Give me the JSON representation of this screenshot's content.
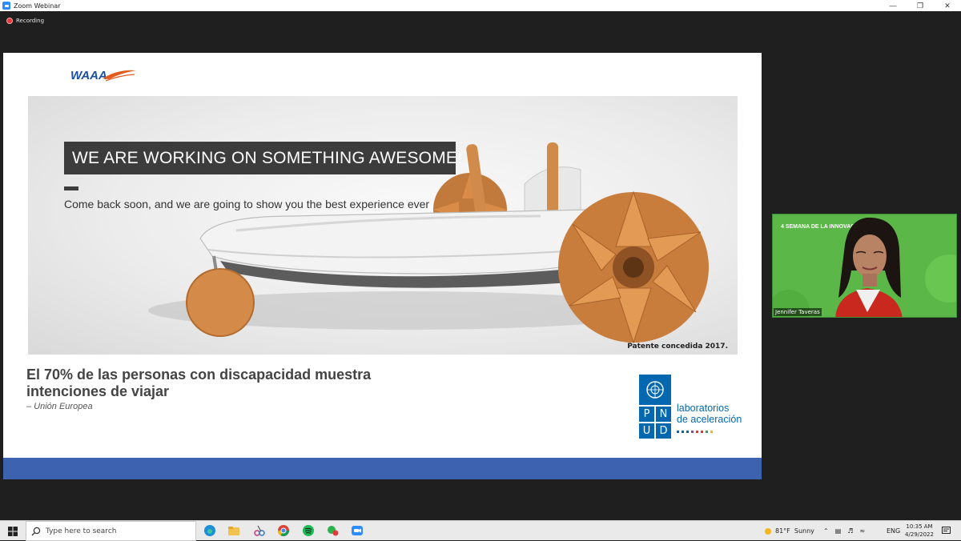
{
  "window": {
    "title": "Zoom Webinar",
    "recording_label": "Recording"
  },
  "slide": {
    "logo_text": "WAAA",
    "banner": "WE ARE WORKING ON SOMETHING AWESOME!",
    "subline": "Come back soon, and we are going to show you the best experience ever",
    "patent": "Patente concedida 2017.",
    "stat_line1": "El 70% de las personas con discapacidad muestra",
    "stat_line2": "intenciones de viajar",
    "source": "– Unión Europea",
    "undp": {
      "letters": [
        "P",
        "N",
        "U",
        "D"
      ],
      "line1": "laboratorios",
      "line2": "de aceleración"
    },
    "colors": {
      "bottom_bar": "#3d63b0",
      "undp_blue": "#0468b1",
      "banner_bg": "#3c3c3c"
    }
  },
  "video": {
    "participant_name": "Jennifer Taveras",
    "background_text": "4 SEMANA DE LA INNOVACIÓN"
  },
  "taskbar": {
    "search_placeholder": "Type here to search",
    "weather": "81°F  Sunny",
    "language": "ENG",
    "time": "10:35 AM",
    "date": "4/29/2022"
  }
}
